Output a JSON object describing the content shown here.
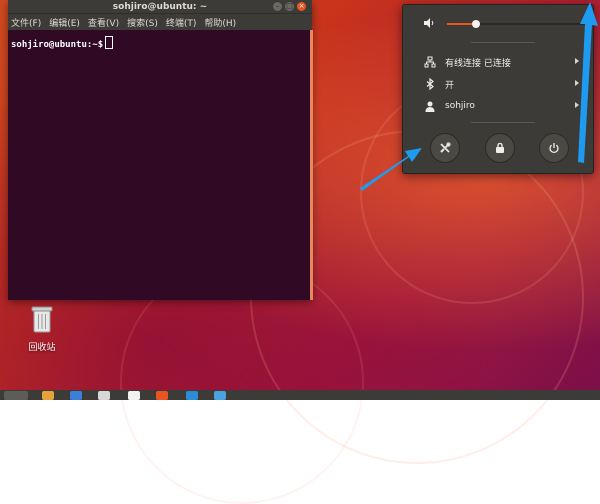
{
  "terminal": {
    "title": "sohjiro@ubuntu: ~",
    "menu": [
      "文件(F)",
      "编辑(E)",
      "查看(V)",
      "搜索(S)",
      "终端(T)",
      "帮助(H)"
    ],
    "prompt": "sohjiro@ubuntu:~$"
  },
  "desktop": {
    "trash_label": "回收站"
  },
  "status_menu": {
    "volume_level_percent": 21,
    "network_label": "有线连接 已连接",
    "bluetooth_label": "开",
    "user_label": "sohjiro",
    "actions": [
      "settings-icon",
      "lock-icon",
      "power-icon"
    ]
  },
  "colors": {
    "accent": "#e95420",
    "terminal_bg": "#300a24",
    "panel_bg": "#3c3b37",
    "annotation_arrow": "#1e9bf0"
  }
}
